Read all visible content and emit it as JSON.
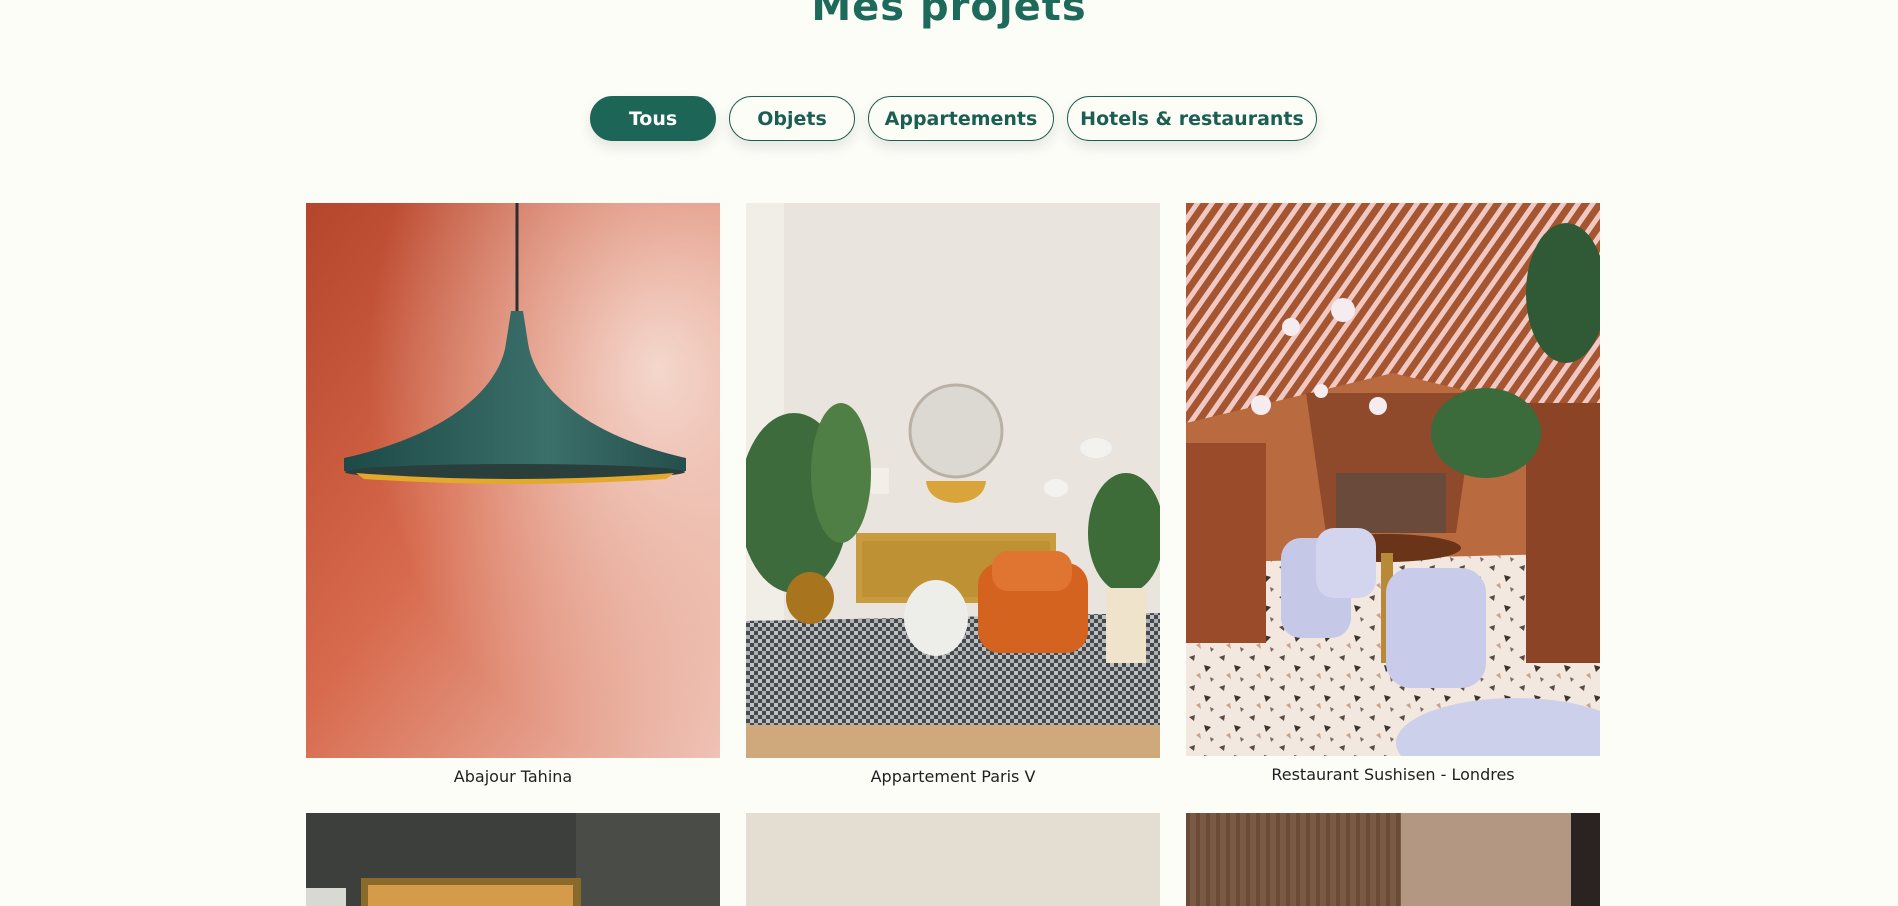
{
  "page": {
    "title": "Mes projets"
  },
  "filters": [
    {
      "label": "Tous",
      "active": true
    },
    {
      "label": "Objets",
      "active": false
    },
    {
      "label": "Appartements",
      "active": false
    },
    {
      "label": "Hotels & restaurants",
      "active": false
    }
  ],
  "projects": [
    {
      "caption": "Abajour Tahina"
    },
    {
      "caption": "Appartement Paris V"
    },
    {
      "caption": "Restaurant Sushisen - Londres"
    }
  ],
  "colors": {
    "accent": "#1d6657",
    "background": "#fdfdf8"
  }
}
